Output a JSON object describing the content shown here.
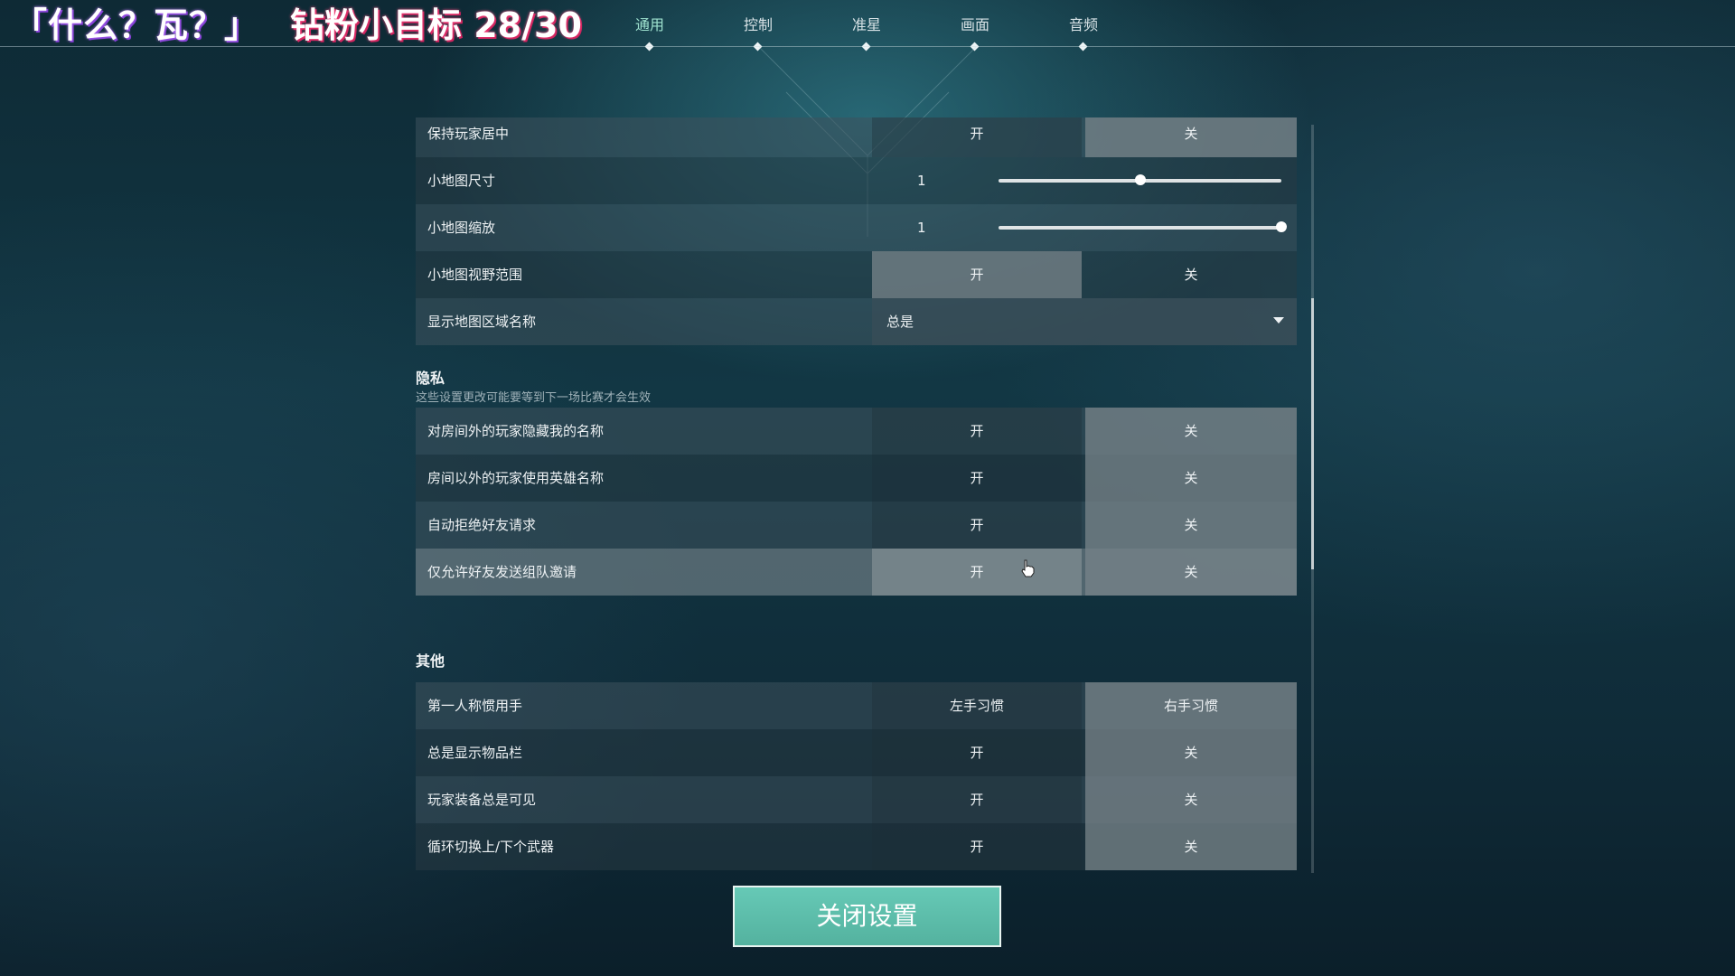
{
  "overlay": {
    "brand": "「什么？瓦？」",
    "goal": "钻粉小目标 28/30"
  },
  "tabs": [
    {
      "label": "通用",
      "active": true
    },
    {
      "label": "控制",
      "active": false
    },
    {
      "label": "准星",
      "active": false
    },
    {
      "label": "画面",
      "active": false
    },
    {
      "label": "音频",
      "active": false
    }
  ],
  "map_settings": [
    {
      "label": "保持玩家居中",
      "on": "开",
      "off": "关",
      "selected": "off"
    },
    {
      "label": "小地图尺寸",
      "value": "1",
      "slider_fraction": 0.5
    },
    {
      "label": "小地图缩放",
      "value": "1",
      "slider_fraction": 1.0
    },
    {
      "label": "小地图视野范围",
      "on": "开",
      "off": "关",
      "selected": "on"
    },
    {
      "label": "显示地图区域名称",
      "dropdown_value": "总是"
    }
  ],
  "privacy": {
    "title": "隐私",
    "note": "这些设置更改可能要等到下一场比赛才会生效",
    "rows": [
      {
        "label": "对房间外的玩家隐藏我的名称",
        "on": "开",
        "off": "关",
        "selected": "off"
      },
      {
        "label": "房间以外的玩家使用英雄名称",
        "on": "开",
        "off": "关",
        "selected": "off"
      },
      {
        "label": "自动拒绝好友请求",
        "on": "开",
        "off": "关",
        "selected": "off"
      },
      {
        "label": "仅允许好友发送组队邀请",
        "on": "开",
        "off": "关",
        "selected": "off"
      }
    ]
  },
  "other": {
    "title": "其他",
    "rows": [
      {
        "label": "第一人称惯用手",
        "on": "左手习惯",
        "off": "右手习惯",
        "selected": "off"
      },
      {
        "label": "总是显示物品栏",
        "on": "开",
        "off": "关",
        "selected": "off"
      },
      {
        "label": "玩家装备总是可见",
        "on": "开",
        "off": "关",
        "selected": "off"
      },
      {
        "label": "循环切换上/下个武器",
        "on": "开",
        "off": "关",
        "selected": "off"
      }
    ]
  },
  "close_button": "关闭设置"
}
